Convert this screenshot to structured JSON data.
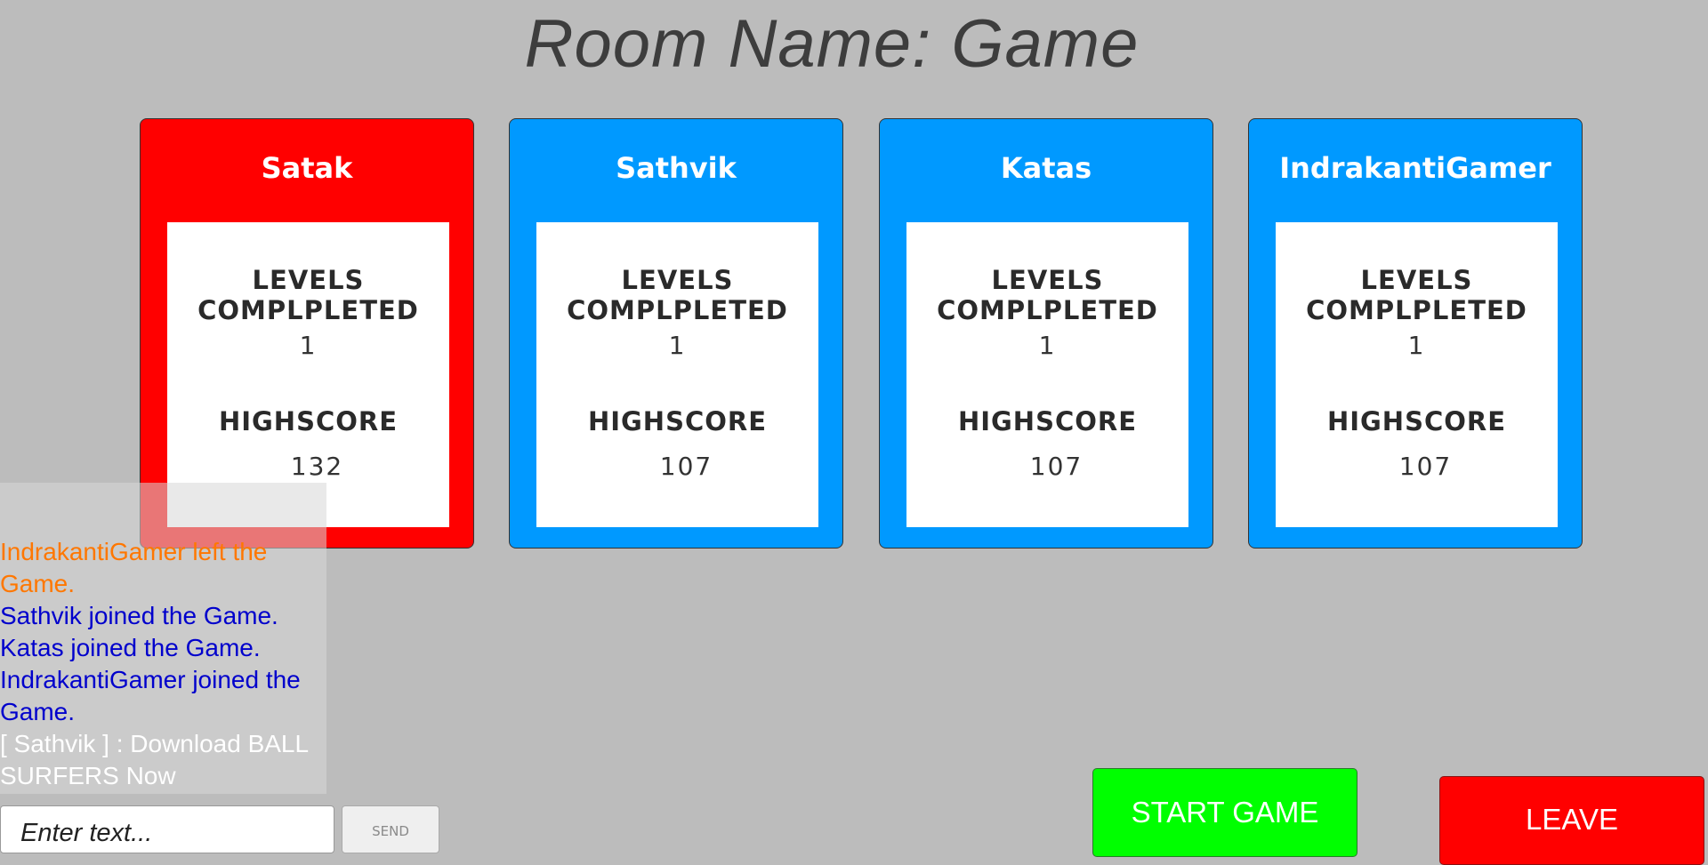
{
  "room": {
    "title": "Room Name: Game"
  },
  "players": [
    {
      "name": "Satak",
      "color": "#ff0000",
      "levels_label": "LEVELS COMPLPLETED",
      "levels": "1",
      "highscore_label": "HIGHSCORE",
      "highscore": "132"
    },
    {
      "name": "Sathvik",
      "color": "#0099ff",
      "levels_label": "LEVELS COMPLPLETED",
      "levels": "1",
      "highscore_label": "HIGHSCORE",
      "highscore": "107"
    },
    {
      "name": "Katas",
      "color": "#0099ff",
      "levels_label": "LEVELS COMPLPLETED",
      "levels": "1",
      "highscore_label": "HIGHSCORE",
      "highscore": "107"
    },
    {
      "name": "IndrakantiGamer",
      "color": "#0099ff",
      "levels_label": "LEVELS COMPLPLETED",
      "levels": "1",
      "highscore_label": "HIGHSCORE",
      "highscore": "107"
    }
  ],
  "chat": {
    "messages": [
      {
        "text": "IndrakantiGamer left the Game.",
        "color": "#ff7700"
      },
      {
        "text": "Sathvik joined the Game.",
        "color": "#0000cc"
      },
      {
        "text": "Katas joined the Game.",
        "color": "#0000cc"
      },
      {
        "text": "IndrakantiGamer joined the Game.",
        "color": "#0000cc"
      },
      {
        "text": " [ Sathvik ] : Download BALL SURFERS Now",
        "color": "#ffffff"
      }
    ],
    "input_placeholder": "Enter text...",
    "send_label": "SEND"
  },
  "buttons": {
    "start_label": "START GAME",
    "leave_label": "LEAVE"
  }
}
